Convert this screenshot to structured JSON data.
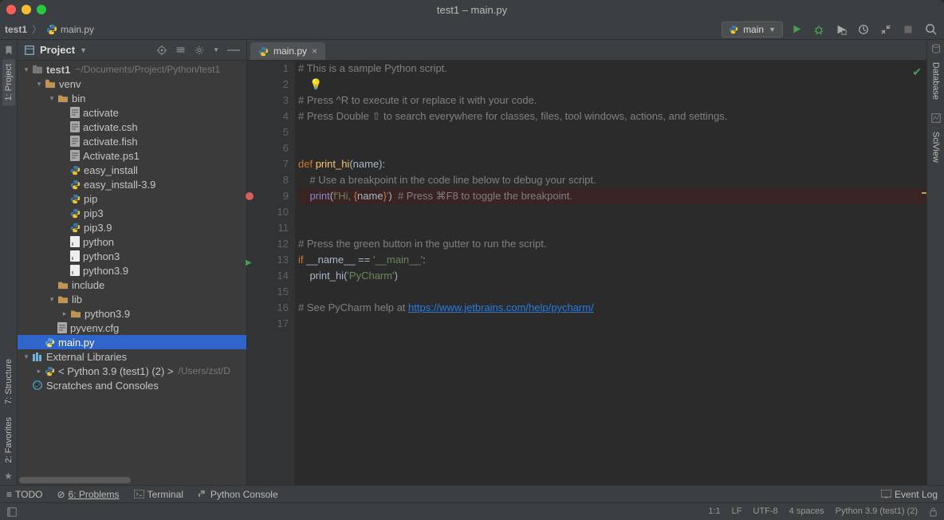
{
  "window": {
    "title": "test1 – main.py"
  },
  "breadcrumb": {
    "root": "test1",
    "file": "main.py"
  },
  "run_config": {
    "label": "main"
  },
  "project_header": {
    "label": "Project"
  },
  "left_tabs": {
    "project": "1: Project",
    "structure": "7: Structure",
    "favorites": "2: Favorites"
  },
  "right_tabs": {
    "database": "Database",
    "sciview": "SciView"
  },
  "tree": {
    "root": {
      "name": "test1",
      "path": "~/Documents/Project/Python/test1"
    },
    "venv": "venv",
    "bin": "bin",
    "files": {
      "activate": "activate",
      "activate_csh": "activate.csh",
      "activate_fish": "activate.fish",
      "activate_ps1": "Activate.ps1",
      "easy_install": "easy_install",
      "easy_install_39": "easy_install-3.9",
      "pip": "pip",
      "pip3": "pip3",
      "pip39": "pip3.9",
      "python": "python",
      "python3": "python3",
      "python39": "python3.9"
    },
    "include": "include",
    "lib": "lib",
    "lib_py39": "python3.9",
    "pyvenv_cfg": "pyvenv.cfg",
    "main_py": "main.py",
    "ext_libs": "External Libraries",
    "sdk": "< Python 3.9 (test1) (2) >",
    "sdk_path": "/Users/zst/D",
    "scratches": "Scratches and Consoles"
  },
  "editor_tab": {
    "label": "main.py"
  },
  "code": {
    "l1": "# This is a sample Python script.",
    "l3": "# Press ^R to execute it or replace it with your code.",
    "l4": "# Press Double ⇧ to search everywhere for classes, files, tool windows, actions, and settings.",
    "l7_def": "def ",
    "l7_name": "print_hi",
    "l7_params": "(name):",
    "l8": "    # Use a breakpoint in the code line below to debug your script.",
    "l9_print": "print",
    "l9_open": "(",
    "l9_f": "f'Hi, ",
    "l9_expr_open": "{",
    "l9_expr": "name",
    "l9_expr_close": "}",
    "l9_close_str": "'",
    "l9_paren": ")",
    "l9_comment": "  # Press ⌘F8 to toggle the breakpoint.",
    "l12": "# Press the green button in the gutter to run the script.",
    "l13_if": "if ",
    "l13_name": "__name__ == ",
    "l13_str": "'__main__'",
    "l13_colon": ":",
    "l14_call": "    print_hi(",
    "l14_str": "'PyCharm'",
    "l14_end": ")",
    "l16_pre": "# See PyCharm help at ",
    "l16_link": "https://www.jetbrains.com/help/pycharm/"
  },
  "bottom_tools": {
    "todo": "TODO",
    "problems": "6: Problems",
    "terminal": "Terminal",
    "console": "Python Console",
    "event_log": "Event Log"
  },
  "status": {
    "pos": "1:1",
    "le": "LF",
    "enc": "UTF-8",
    "indent": "4 spaces",
    "sdk": "Python 3.9 (test1) (2)"
  }
}
